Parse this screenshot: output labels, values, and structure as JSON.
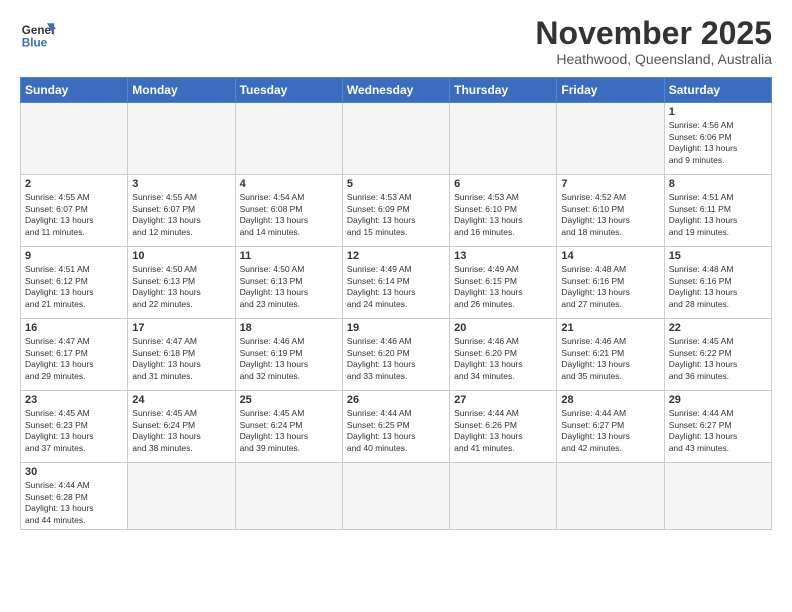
{
  "header": {
    "logo_general": "General",
    "logo_blue": "Blue",
    "title": "November 2025",
    "subtitle": "Heathwood, Queensland, Australia"
  },
  "weekdays": [
    "Sunday",
    "Monday",
    "Tuesday",
    "Wednesday",
    "Thursday",
    "Friday",
    "Saturday"
  ],
  "weeks": [
    [
      {
        "day": "",
        "info": ""
      },
      {
        "day": "",
        "info": ""
      },
      {
        "day": "",
        "info": ""
      },
      {
        "day": "",
        "info": ""
      },
      {
        "day": "",
        "info": ""
      },
      {
        "day": "",
        "info": ""
      },
      {
        "day": "1",
        "info": "Sunrise: 4:56 AM\nSunset: 6:06 PM\nDaylight: 13 hours\nand 9 minutes."
      }
    ],
    [
      {
        "day": "2",
        "info": "Sunrise: 4:55 AM\nSunset: 6:07 PM\nDaylight: 13 hours\nand 11 minutes."
      },
      {
        "day": "3",
        "info": "Sunrise: 4:55 AM\nSunset: 6:07 PM\nDaylight: 13 hours\nand 12 minutes."
      },
      {
        "day": "4",
        "info": "Sunrise: 4:54 AM\nSunset: 6:08 PM\nDaylight: 13 hours\nand 14 minutes."
      },
      {
        "day": "5",
        "info": "Sunrise: 4:53 AM\nSunset: 6:09 PM\nDaylight: 13 hours\nand 15 minutes."
      },
      {
        "day": "6",
        "info": "Sunrise: 4:53 AM\nSunset: 6:10 PM\nDaylight: 13 hours\nand 16 minutes."
      },
      {
        "day": "7",
        "info": "Sunrise: 4:52 AM\nSunset: 6:10 PM\nDaylight: 13 hours\nand 18 minutes."
      },
      {
        "day": "8",
        "info": "Sunrise: 4:51 AM\nSunset: 6:11 PM\nDaylight: 13 hours\nand 19 minutes."
      }
    ],
    [
      {
        "day": "9",
        "info": "Sunrise: 4:51 AM\nSunset: 6:12 PM\nDaylight: 13 hours\nand 21 minutes."
      },
      {
        "day": "10",
        "info": "Sunrise: 4:50 AM\nSunset: 6:13 PM\nDaylight: 13 hours\nand 22 minutes."
      },
      {
        "day": "11",
        "info": "Sunrise: 4:50 AM\nSunset: 6:13 PM\nDaylight: 13 hours\nand 23 minutes."
      },
      {
        "day": "12",
        "info": "Sunrise: 4:49 AM\nSunset: 6:14 PM\nDaylight: 13 hours\nand 24 minutes."
      },
      {
        "day": "13",
        "info": "Sunrise: 4:49 AM\nSunset: 6:15 PM\nDaylight: 13 hours\nand 26 minutes."
      },
      {
        "day": "14",
        "info": "Sunrise: 4:48 AM\nSunset: 6:16 PM\nDaylight: 13 hours\nand 27 minutes."
      },
      {
        "day": "15",
        "info": "Sunrise: 4:48 AM\nSunset: 6:16 PM\nDaylight: 13 hours\nand 28 minutes."
      }
    ],
    [
      {
        "day": "16",
        "info": "Sunrise: 4:47 AM\nSunset: 6:17 PM\nDaylight: 13 hours\nand 29 minutes."
      },
      {
        "day": "17",
        "info": "Sunrise: 4:47 AM\nSunset: 6:18 PM\nDaylight: 13 hours\nand 31 minutes."
      },
      {
        "day": "18",
        "info": "Sunrise: 4:46 AM\nSunset: 6:19 PM\nDaylight: 13 hours\nand 32 minutes."
      },
      {
        "day": "19",
        "info": "Sunrise: 4:46 AM\nSunset: 6:20 PM\nDaylight: 13 hours\nand 33 minutes."
      },
      {
        "day": "20",
        "info": "Sunrise: 4:46 AM\nSunset: 6:20 PM\nDaylight: 13 hours\nand 34 minutes."
      },
      {
        "day": "21",
        "info": "Sunrise: 4:46 AM\nSunset: 6:21 PM\nDaylight: 13 hours\nand 35 minutes."
      },
      {
        "day": "22",
        "info": "Sunrise: 4:45 AM\nSunset: 6:22 PM\nDaylight: 13 hours\nand 36 minutes."
      }
    ],
    [
      {
        "day": "23",
        "info": "Sunrise: 4:45 AM\nSunset: 6:23 PM\nDaylight: 13 hours\nand 37 minutes."
      },
      {
        "day": "24",
        "info": "Sunrise: 4:45 AM\nSunset: 6:24 PM\nDaylight: 13 hours\nand 38 minutes."
      },
      {
        "day": "25",
        "info": "Sunrise: 4:45 AM\nSunset: 6:24 PM\nDaylight: 13 hours\nand 39 minutes."
      },
      {
        "day": "26",
        "info": "Sunrise: 4:44 AM\nSunset: 6:25 PM\nDaylight: 13 hours\nand 40 minutes."
      },
      {
        "day": "27",
        "info": "Sunrise: 4:44 AM\nSunset: 6:26 PM\nDaylight: 13 hours\nand 41 minutes."
      },
      {
        "day": "28",
        "info": "Sunrise: 4:44 AM\nSunset: 6:27 PM\nDaylight: 13 hours\nand 42 minutes."
      },
      {
        "day": "29",
        "info": "Sunrise: 4:44 AM\nSunset: 6:27 PM\nDaylight: 13 hours\nand 43 minutes."
      }
    ],
    [
      {
        "day": "30",
        "info": "Sunrise: 4:44 AM\nSunset: 6:28 PM\nDaylight: 13 hours\nand 44 minutes."
      },
      {
        "day": "",
        "info": ""
      },
      {
        "day": "",
        "info": ""
      },
      {
        "day": "",
        "info": ""
      },
      {
        "day": "",
        "info": ""
      },
      {
        "day": "",
        "info": ""
      },
      {
        "day": "",
        "info": ""
      }
    ]
  ]
}
